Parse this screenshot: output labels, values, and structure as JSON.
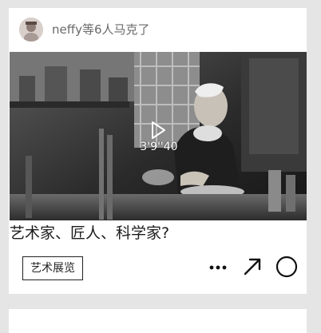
{
  "feed_card": {
    "header": {
      "text": "neffy等6人马克了",
      "avatar_icon": "user-avatar-icon"
    },
    "media": {
      "duration": "3'9''40",
      "play_icon": "play-icon"
    },
    "title": "艺术家、匠人、科学家?",
    "tag": "艺术展览",
    "actions": {
      "more_icon": "more-icon",
      "share_icon": "share-arrow-icon",
      "mark_icon": "circle-mark-icon"
    }
  },
  "colors": {
    "page_background": "#e5e5e5",
    "card_background": "#ffffff",
    "text_dark": "#1c1c1c",
    "text_muted": "#6a6a6a"
  }
}
